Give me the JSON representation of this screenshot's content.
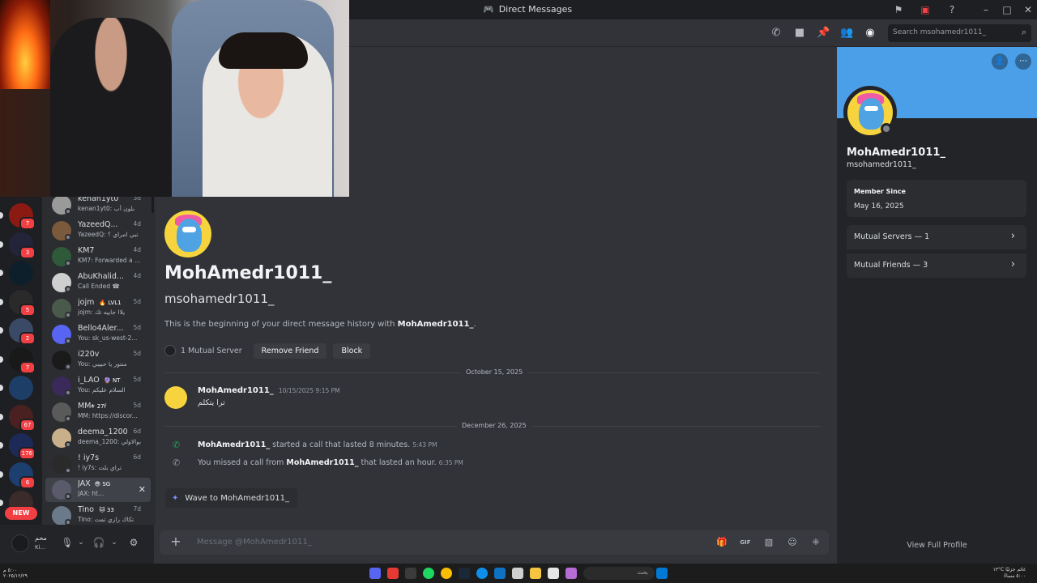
{
  "window": {
    "title": "Direct Messages"
  },
  "header": {
    "search_placeholder": "Search msohamedr1011_"
  },
  "servers": [
    {
      "color": "#8b1a12",
      "badge": "7"
    },
    {
      "color": "#23243a",
      "badge": "3"
    },
    {
      "color": "#0d1f2a",
      "badge": ""
    },
    {
      "color": "#2a2a2a",
      "badge": "5"
    },
    {
      "color": "#3a4a66",
      "badge": "2"
    },
    {
      "color": "#191919",
      "badge": "7"
    },
    {
      "color": "#1d3e66",
      "badge": ""
    },
    {
      "color": "#4a2020",
      "badge": "67"
    },
    {
      "color": "#1d2a57",
      "badge": "176"
    },
    {
      "color": "#1c3f6f",
      "badge": "6"
    },
    {
      "color": "#3b2b2b",
      "badge": ""
    }
  ],
  "new_label": "NEW",
  "dms": [
    {
      "name": "kenan1yt0",
      "sub": "kenan1yt0: بلون أب",
      "time": "3d",
      "color": "#9a9a9a",
      "tag": ""
    },
    {
      "name": "YazeedQ...",
      "sub": "YazeedQ: تبي امراي ؟",
      "time": "4d",
      "color": "#7a5a3a",
      "tag": ""
    },
    {
      "name": "KM7",
      "sub": "KM7: Forwarded a ...",
      "time": "4d",
      "color": "#2f5a3a",
      "tag": ""
    },
    {
      "name": "AbuKhalid...",
      "sub": "Call Ended ☎",
      "time": "4d",
      "color": "#cfcfcf",
      "tag": ""
    },
    {
      "name": "jojm",
      "sub": "jojm: يلاا جاييه تك",
      "time": "5d",
      "color": "#4a5a4a",
      "tag": "🔥 LVL1"
    },
    {
      "name": "Bello4Aler...",
      "sub": "You: sk_us-west-2...",
      "time": "5d",
      "color": "#5865f2",
      "tag": ""
    },
    {
      "name": "i220v",
      "sub": "You: منتور يا حبيبي",
      "time": "5d",
      "color": "#1a1a1a",
      "tag": ""
    },
    {
      "name": "i_LAO",
      "sub": "You: السلام عليكم",
      "time": "5d",
      "color": "#3a2a5a",
      "tag": "🔮 NT"
    },
    {
      "name": "MM",
      "sub": "MM: https://discor...",
      "time": "5d",
      "color": "#5a5a5a",
      "tag": "⚜ 27f"
    },
    {
      "name": "deema_1200",
      "sub": "deema_1200: بوالاولي",
      "time": "6d",
      "color": "#c9b08a",
      "tag": ""
    },
    {
      "name": "! iy7s",
      "sub": "! iy7s: تراي بلت",
      "time": "6d",
      "color": "#2a2a2a",
      "tag": ""
    },
    {
      "name": "JAX",
      "sub": "JAX: ht...",
      "time": "",
      "color": "#5a5a6a",
      "tag": "😎 SG"
    },
    {
      "name": "Tino",
      "sub": "Tino: تكاك رازي تمت",
      "time": "7d",
      "color": "#6a7a8a",
      "tag": "🐱 33"
    }
  ],
  "user_panel": {
    "name": "ﻣﺤﻢ",
    "status": "Ki..."
  },
  "profile": {
    "display_name": "MohAmedr1011_",
    "username": "msohamedr1011_",
    "member_since_label": "Member Since",
    "member_since": "May 16, 2025",
    "mutual_servers": "Mutual Servers — 1",
    "mutual_friends": "Mutual Friends — 3",
    "view_full": "View Full Profile",
    "banner_color": "#4a9fe8"
  },
  "chat": {
    "display_name": "MohAmedr1011_",
    "username": "msohamedr1011_",
    "intro_prefix": "This is the beginning of your direct message history with ",
    "intro_name": "MohAmedr1011_",
    "intro_suffix": ".",
    "mutual_server": "1 Mutual Server",
    "remove_friend": "Remove Friend",
    "block": "Block",
    "date1": "October 15, 2025",
    "msg_author": "MohAmedr1011_",
    "msg_time": "10/15/2025 9:15 PM",
    "msg_text": "ترا يتكلم",
    "date2": "December 26, 2025",
    "call1_name": "MohAmedr1011_",
    "call1_text": " started a call that lasted 8 minutes.",
    "call1_time": "5:43 PM",
    "call2_prefix": "You missed a call from ",
    "call2_name": "MohAmedr1011_",
    "call2_suffix": " that lasted an hour.",
    "call2_time": "6:35 PM",
    "wave": "Wave to MohAmedr1011_",
    "composer_placeholder": "Message @MohAmedr1011_"
  },
  "taskbar": {
    "search_text": "بحث",
    "clock_line1": "٥:٠٠ مساءً",
    "clock_line2": "٢٠٢٥/١٢/٢٩",
    "weather": "١٣°C غائم جزئيًا",
    "left_time": "٥:٠٠ م",
    "left_date": "٢٠٢٥/١٢/٢٩"
  }
}
